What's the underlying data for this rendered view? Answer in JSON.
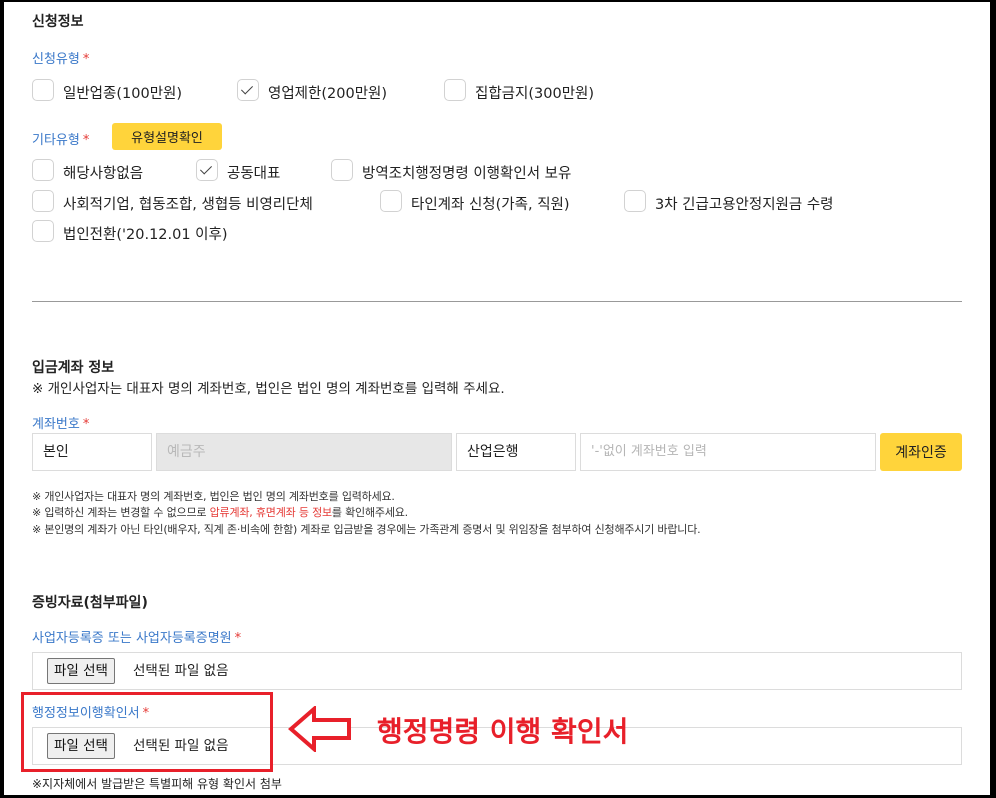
{
  "application_info": {
    "heading": "신청정보",
    "type": {
      "label": "신청유형",
      "options": [
        {
          "label": "일반업종(100만원)",
          "checked": false
        },
        {
          "label": "영업제한(200만원)",
          "checked": true
        },
        {
          "label": "집합금지(300만원)",
          "checked": false
        }
      ]
    },
    "other": {
      "label": "기타유형",
      "help_button": "유형설명확인",
      "options": [
        {
          "label": "해당사항없음",
          "checked": false
        },
        {
          "label": "공동대표",
          "checked": true
        },
        {
          "label": "방역조치행정명령 이행확인서 보유",
          "checked": false
        },
        {
          "label": "사회적기업, 협동조합, 생협등 비영리단체",
          "checked": false
        },
        {
          "label": "타인계좌 신청(가족, 직원)",
          "checked": false
        },
        {
          "label": "3차 긴급고용안정지원금 수령",
          "checked": false
        },
        {
          "label": "법인전환('20.12.01 이후)",
          "checked": false
        }
      ]
    }
  },
  "account": {
    "heading": "입금계좌 정보",
    "subtitle": "※ 개인사업자는 대표자 명의 계좌번호, 법인은 법인 명의 계좌번호를 입력해 주세요.",
    "label": "계좌번호",
    "owner_type": "본인",
    "holder_placeholder": "예금주",
    "bank": "산업은행",
    "number_placeholder": "'-'없이 계좌번호 입력",
    "verify_button": "계좌인증",
    "notes": {
      "line1": "※ 개인사업자는 대표자 명의 계좌번호, 법인은 법인 명의 계좌번호를 입력하세요.",
      "line2_a": "※ 입력하신 계좌는 변경할 수 없으므로 ",
      "line2_red": "압류계좌, 휴면계좌 등 정보",
      "line2_b": "를 확인해주세요.",
      "line3": "※ 본인명의 계좌가 아닌 타인(배우자, 직계 존·비속에 한함) 계좌로 입금받을 경우에는 가족관계 증명서 및 위임장을 첨부하여 신청해주시기 바랍니다."
    }
  },
  "evidence": {
    "heading": "증빙자료(첨부파일)",
    "business_cert": {
      "label": "사업자등록증 또는 사업자등록증명원",
      "button": "파일 선택",
      "status": "선택된 파일 없음"
    },
    "admin_confirm": {
      "label": "행정정보이행확인서",
      "button": "파일 선택",
      "status": "선택된 파일 없음"
    },
    "footnote": "※지자체에서 발급받은 특별피해 유형 확인서 첨부"
  },
  "annotation": {
    "text": "행정명령 이행 확인서",
    "color": "#e8202a"
  },
  "colors": {
    "accent_blue": "#3a78c9",
    "button_yellow": "#ffd43b",
    "required_red": "#e53935"
  }
}
